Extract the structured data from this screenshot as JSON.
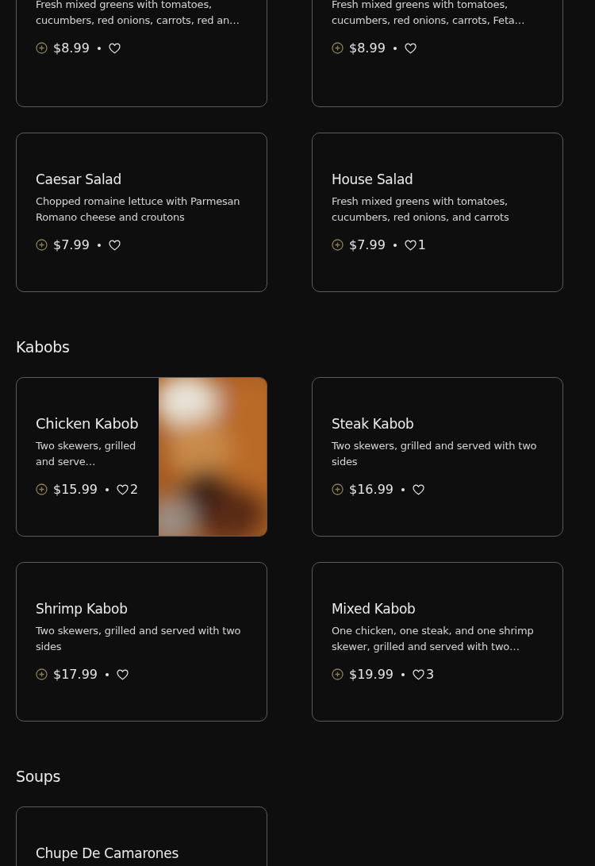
{
  "sections": [
    {
      "items": [
        {
          "description": "Fresh mixed greens with tomatoes, cucumbers, red onions, carrots, red an…",
          "price": "$8.99"
        },
        {
          "description": "Fresh mixed greens with tomatoes, cucumbers, red onions, carrots, Feta…",
          "price": "$8.99"
        },
        {
          "title": "Caesar Salad",
          "description": "Chopped romaine lettuce with Parmesan Romano cheese and croutons",
          "price": "$7.99"
        },
        {
          "title": "House Salad",
          "description": "Fresh mixed greens with tomatoes, cucumbers, red onions, and carrots",
          "price": "$7.99",
          "likes": "1"
        }
      ]
    },
    {
      "title": "Kabobs",
      "items": [
        {
          "title": "Chicken Kabob",
          "description": "Two skewers, grilled and serve…",
          "price": "$15.99",
          "likes": "2"
        },
        {
          "title": "Steak Kabob",
          "description": "Two skewers, grilled and served with two sides",
          "price": "$16.99"
        },
        {
          "title": "Shrimp Kabob",
          "description": "Two skewers, grilled and served with two sides",
          "price": "$17.99"
        },
        {
          "title": "Mixed Kabob",
          "description": "One chicken, one steak, and one shrimp skewer, grilled and served with two…",
          "price": "$19.99",
          "likes": "3"
        }
      ]
    },
    {
      "title": "Soups",
      "items": [
        {
          "title": "Chupe De Camarones"
        }
      ]
    }
  ]
}
